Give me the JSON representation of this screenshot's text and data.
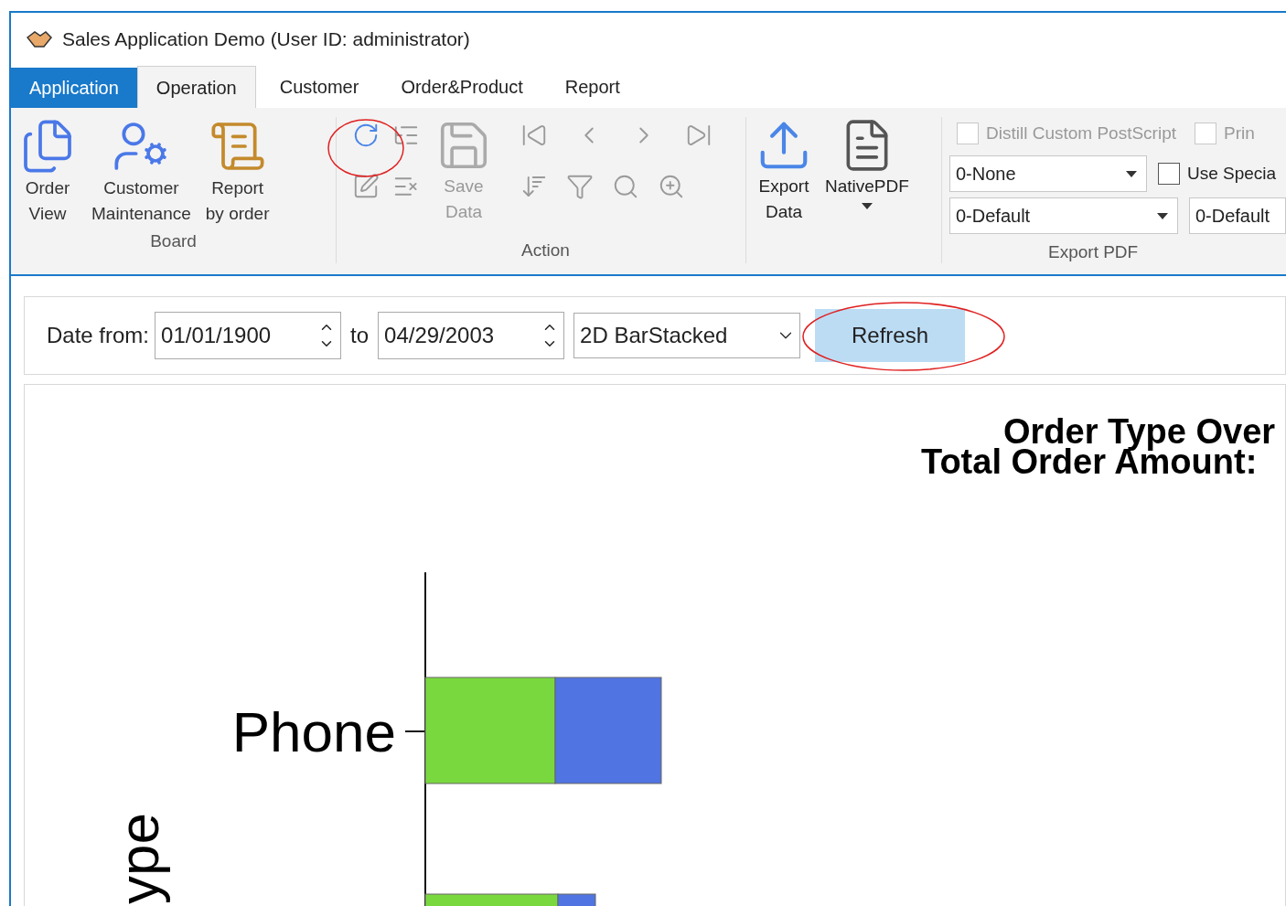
{
  "window": {
    "title": "Sales Application Demo (User ID: administrator)"
  },
  "tabs": [
    {
      "label": "Application",
      "kind": "backstage",
      "selected": false
    },
    {
      "label": "Operation",
      "kind": "tab",
      "selected": true
    },
    {
      "label": "Customer",
      "kind": "tab",
      "selected": false
    },
    {
      "label": "Order&Product",
      "kind": "tab",
      "selected": false
    },
    {
      "label": "Report",
      "kind": "tab",
      "selected": false
    }
  ],
  "ribbon": {
    "board": {
      "label": "Board",
      "buttons": [
        {
          "kind": "order-view",
          "lines": [
            "Order",
            "View"
          ]
        },
        {
          "kind": "customer",
          "lines": [
            "Customer",
            "Maintenance"
          ]
        },
        {
          "kind": "report",
          "lines": [
            "Report",
            "by order"
          ]
        }
      ]
    },
    "action": {
      "label": "Action",
      "tools_top": [
        {
          "kind": "refresh",
          "disabled": false
        },
        {
          "kind": "tree",
          "disabled": true
        }
      ],
      "tools_bottom": [
        {
          "kind": "edit",
          "disabled": true
        },
        {
          "kind": "delete",
          "disabled": true
        }
      ],
      "save": {
        "lines": [
          "Save",
          "Data"
        ],
        "disabled": true
      },
      "nav": [
        {
          "kind": "first",
          "disabled": true
        },
        {
          "kind": "prev",
          "disabled": true
        },
        {
          "kind": "next",
          "disabled": true
        },
        {
          "kind": "last",
          "disabled": true
        }
      ],
      "nav_bottom": [
        {
          "kind": "sort",
          "disabled": true
        },
        {
          "kind": "filter",
          "disabled": true
        },
        {
          "kind": "search",
          "disabled": true
        },
        {
          "kind": "find-next",
          "disabled": true
        }
      ]
    },
    "export": {
      "export_data": [
        "Export",
        "Data"
      ],
      "native_pdf": "NativePDF"
    },
    "export_pdf": {
      "label": "Export PDF",
      "checkboxes": [
        {
          "label": "Distill Custom PostScript",
          "checked": false,
          "disabled": true
        },
        {
          "label": "Prin",
          "checked": false,
          "disabled": true
        },
        {
          "label": "Use Specia",
          "checked": false,
          "disabled": false
        }
      ],
      "dropdowns": [
        "0-None",
        "0-Default",
        "0-Default"
      ]
    }
  },
  "filter": {
    "date_from_label": "Date from:",
    "date_from": "01/01/1900",
    "to_label": "to",
    "date_to": "04/29/2003",
    "chart_type": "2D BarStacked",
    "refresh": "Refresh"
  },
  "chart": {
    "title": "Order Type Over",
    "subtitle": "Total Order Amount:",
    "axis_title": "ype",
    "categories": [
      "Phone"
    ],
    "series": [
      {
        "color": "#7ad83f"
      },
      {
        "color": "#5074e2"
      }
    ]
  }
}
